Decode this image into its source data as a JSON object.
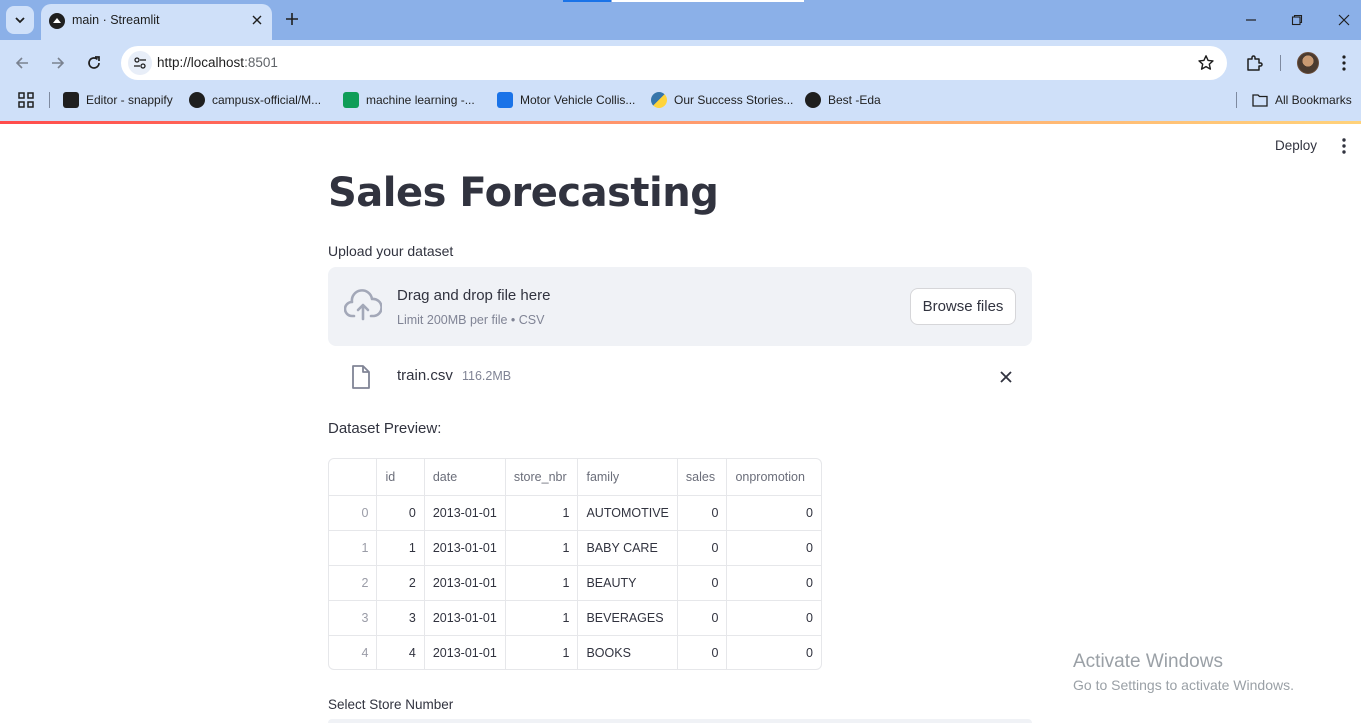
{
  "browser": {
    "tab_title": "main · Streamlit",
    "url_host": "http://localhost",
    "url_port": ":8501",
    "bookmarks": [
      {
        "label": "Editor - snappify",
        "icon": "terminal-icon",
        "color": "#1f1f1f"
      },
      {
        "label": "campusx-official/M...",
        "icon": "github-icon",
        "color": "#1f1f1f"
      },
      {
        "label": "machine learning -...",
        "icon": "sheets-icon",
        "color": "#0f9d58"
      },
      {
        "label": "Motor Vehicle Collis...",
        "icon": "dataset-icon",
        "color": "#1a73e8"
      },
      {
        "label": "Our Success Stories...",
        "icon": "python-icon",
        "color": "#3776ab"
      },
      {
        "label": "Best -Eda",
        "icon": "github-icon",
        "color": "#1f1f1f"
      }
    ],
    "all_bookmarks": "All Bookmarks"
  },
  "app": {
    "deploy": "Deploy",
    "title": "Sales Forecasting",
    "upload_label": "Upload your dataset",
    "dropzone_main": "Drag and drop file here",
    "dropzone_sub": "Limit 200MB per file • CSV",
    "browse": "Browse files",
    "file_name": "train.csv",
    "file_size": "116.2MB",
    "preview_label": "Dataset Preview:",
    "table": {
      "columns": [
        "",
        "id",
        "date",
        "store_nbr",
        "family",
        "sales",
        "onpromotion"
      ],
      "rows": [
        [
          "0",
          "0",
          "2013-01-01",
          "1",
          "AUTOMOTIVE",
          "0",
          "0"
        ],
        [
          "1",
          "1",
          "2013-01-01",
          "1",
          "BABY CARE",
          "0",
          "0"
        ],
        [
          "2",
          "2",
          "2013-01-01",
          "1",
          "BEAUTY",
          "0",
          "0"
        ],
        [
          "3",
          "3",
          "2013-01-01",
          "1",
          "BEVERAGES",
          "0",
          "0"
        ],
        [
          "4",
          "4",
          "2013-01-01",
          "1",
          "BOOKS",
          "0",
          "0"
        ]
      ]
    },
    "select_label": "Select Store Number"
  },
  "watermark": {
    "line1": "Activate Windows",
    "line2": "Go to Settings to activate Windows."
  }
}
